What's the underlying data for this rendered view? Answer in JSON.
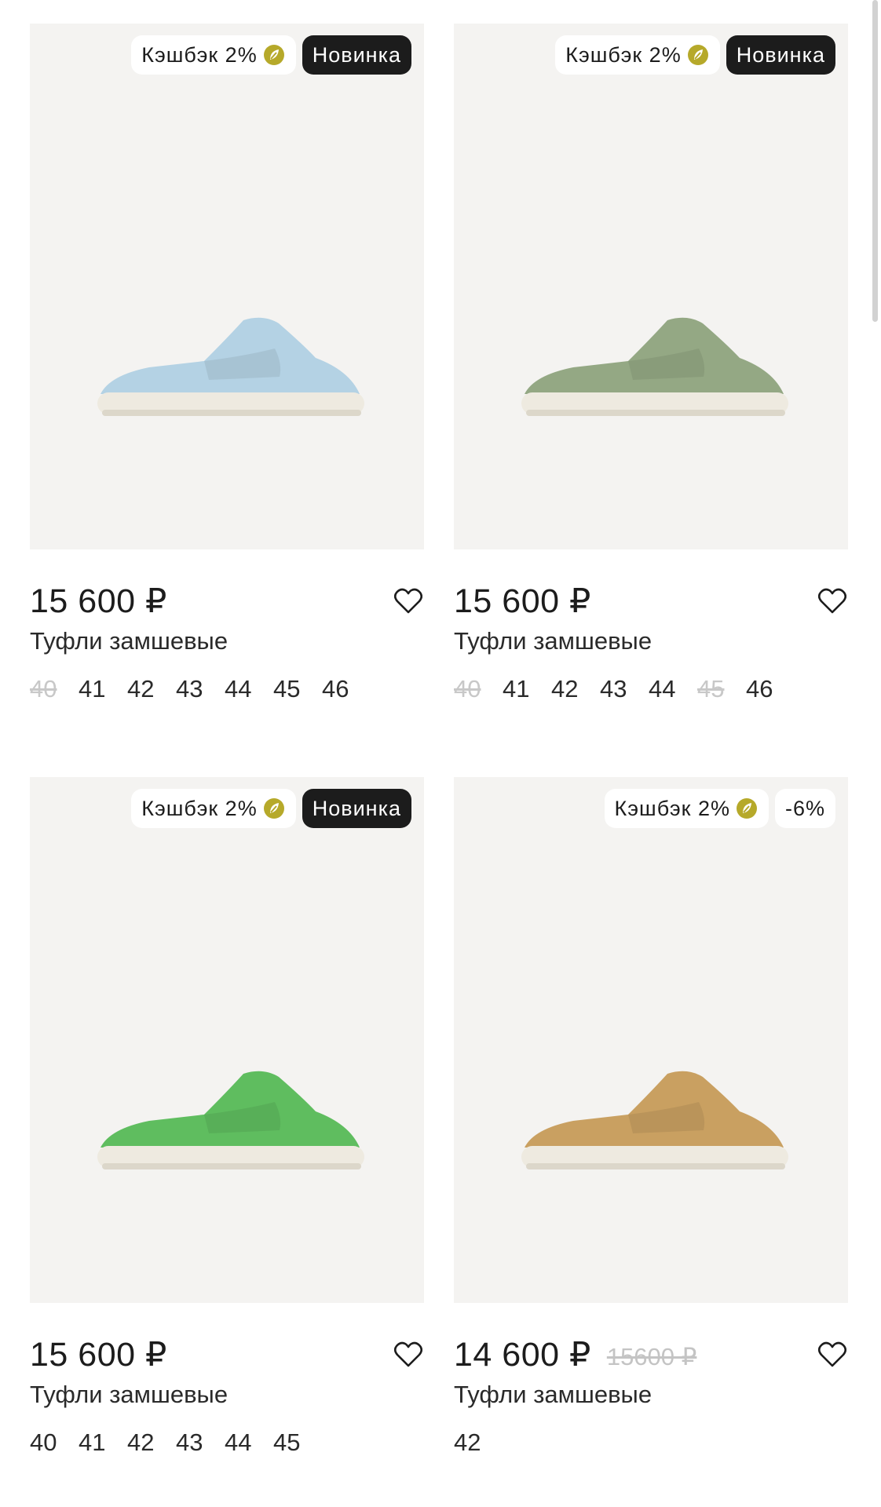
{
  "products": [
    {
      "cashback": "Кэшбэк 2%",
      "badge": "Новинка",
      "price": "15 600 ₽",
      "old_price": "",
      "name": "Туфли замшевые",
      "color": "#b4d2e4",
      "sizes": [
        {
          "label": "40",
          "available": false
        },
        {
          "label": "41",
          "available": true
        },
        {
          "label": "42",
          "available": true
        },
        {
          "label": "43",
          "available": true
        },
        {
          "label": "44",
          "available": true
        },
        {
          "label": "45",
          "available": true
        },
        {
          "label": "46",
          "available": true
        }
      ]
    },
    {
      "cashback": "Кэшбэк 2%",
      "badge": "Новинка",
      "price": "15 600 ₽",
      "old_price": "",
      "name": "Туфли замшевые",
      "color": "#94a884",
      "sizes": [
        {
          "label": "40",
          "available": false
        },
        {
          "label": "41",
          "available": true
        },
        {
          "label": "42",
          "available": true
        },
        {
          "label": "43",
          "available": true
        },
        {
          "label": "44",
          "available": true
        },
        {
          "label": "45",
          "available": false
        },
        {
          "label": "46",
          "available": true
        }
      ]
    },
    {
      "cashback": "Кэшбэк 2%",
      "badge": "Новинка",
      "price": "15 600 ₽",
      "old_price": "",
      "name": "Туфли замшевые",
      "color": "#5fbd5f",
      "sizes": [
        {
          "label": "40",
          "available": true
        },
        {
          "label": "41",
          "available": true
        },
        {
          "label": "42",
          "available": true
        },
        {
          "label": "43",
          "available": true
        },
        {
          "label": "44",
          "available": true
        },
        {
          "label": "45",
          "available": true
        }
      ]
    },
    {
      "cashback": "Кэшбэк 2%",
      "badge": "-6%",
      "price": "14 600 ₽",
      "old_price": "15600 ₽",
      "name": "Туфли замшевые",
      "color": "#c9a061",
      "sizes": [
        {
          "label": "42",
          "available": true
        }
      ]
    }
  ],
  "icons": {
    "cashback": "coin-leaf-icon",
    "favorite": "heart-outline-icon"
  },
  "colors": {
    "photo_bg": "#f4f3f1",
    "badge_dark": "#1c1c1c",
    "cashback_icon": "#b6a92a",
    "unavailable": "#c8c8c8"
  }
}
